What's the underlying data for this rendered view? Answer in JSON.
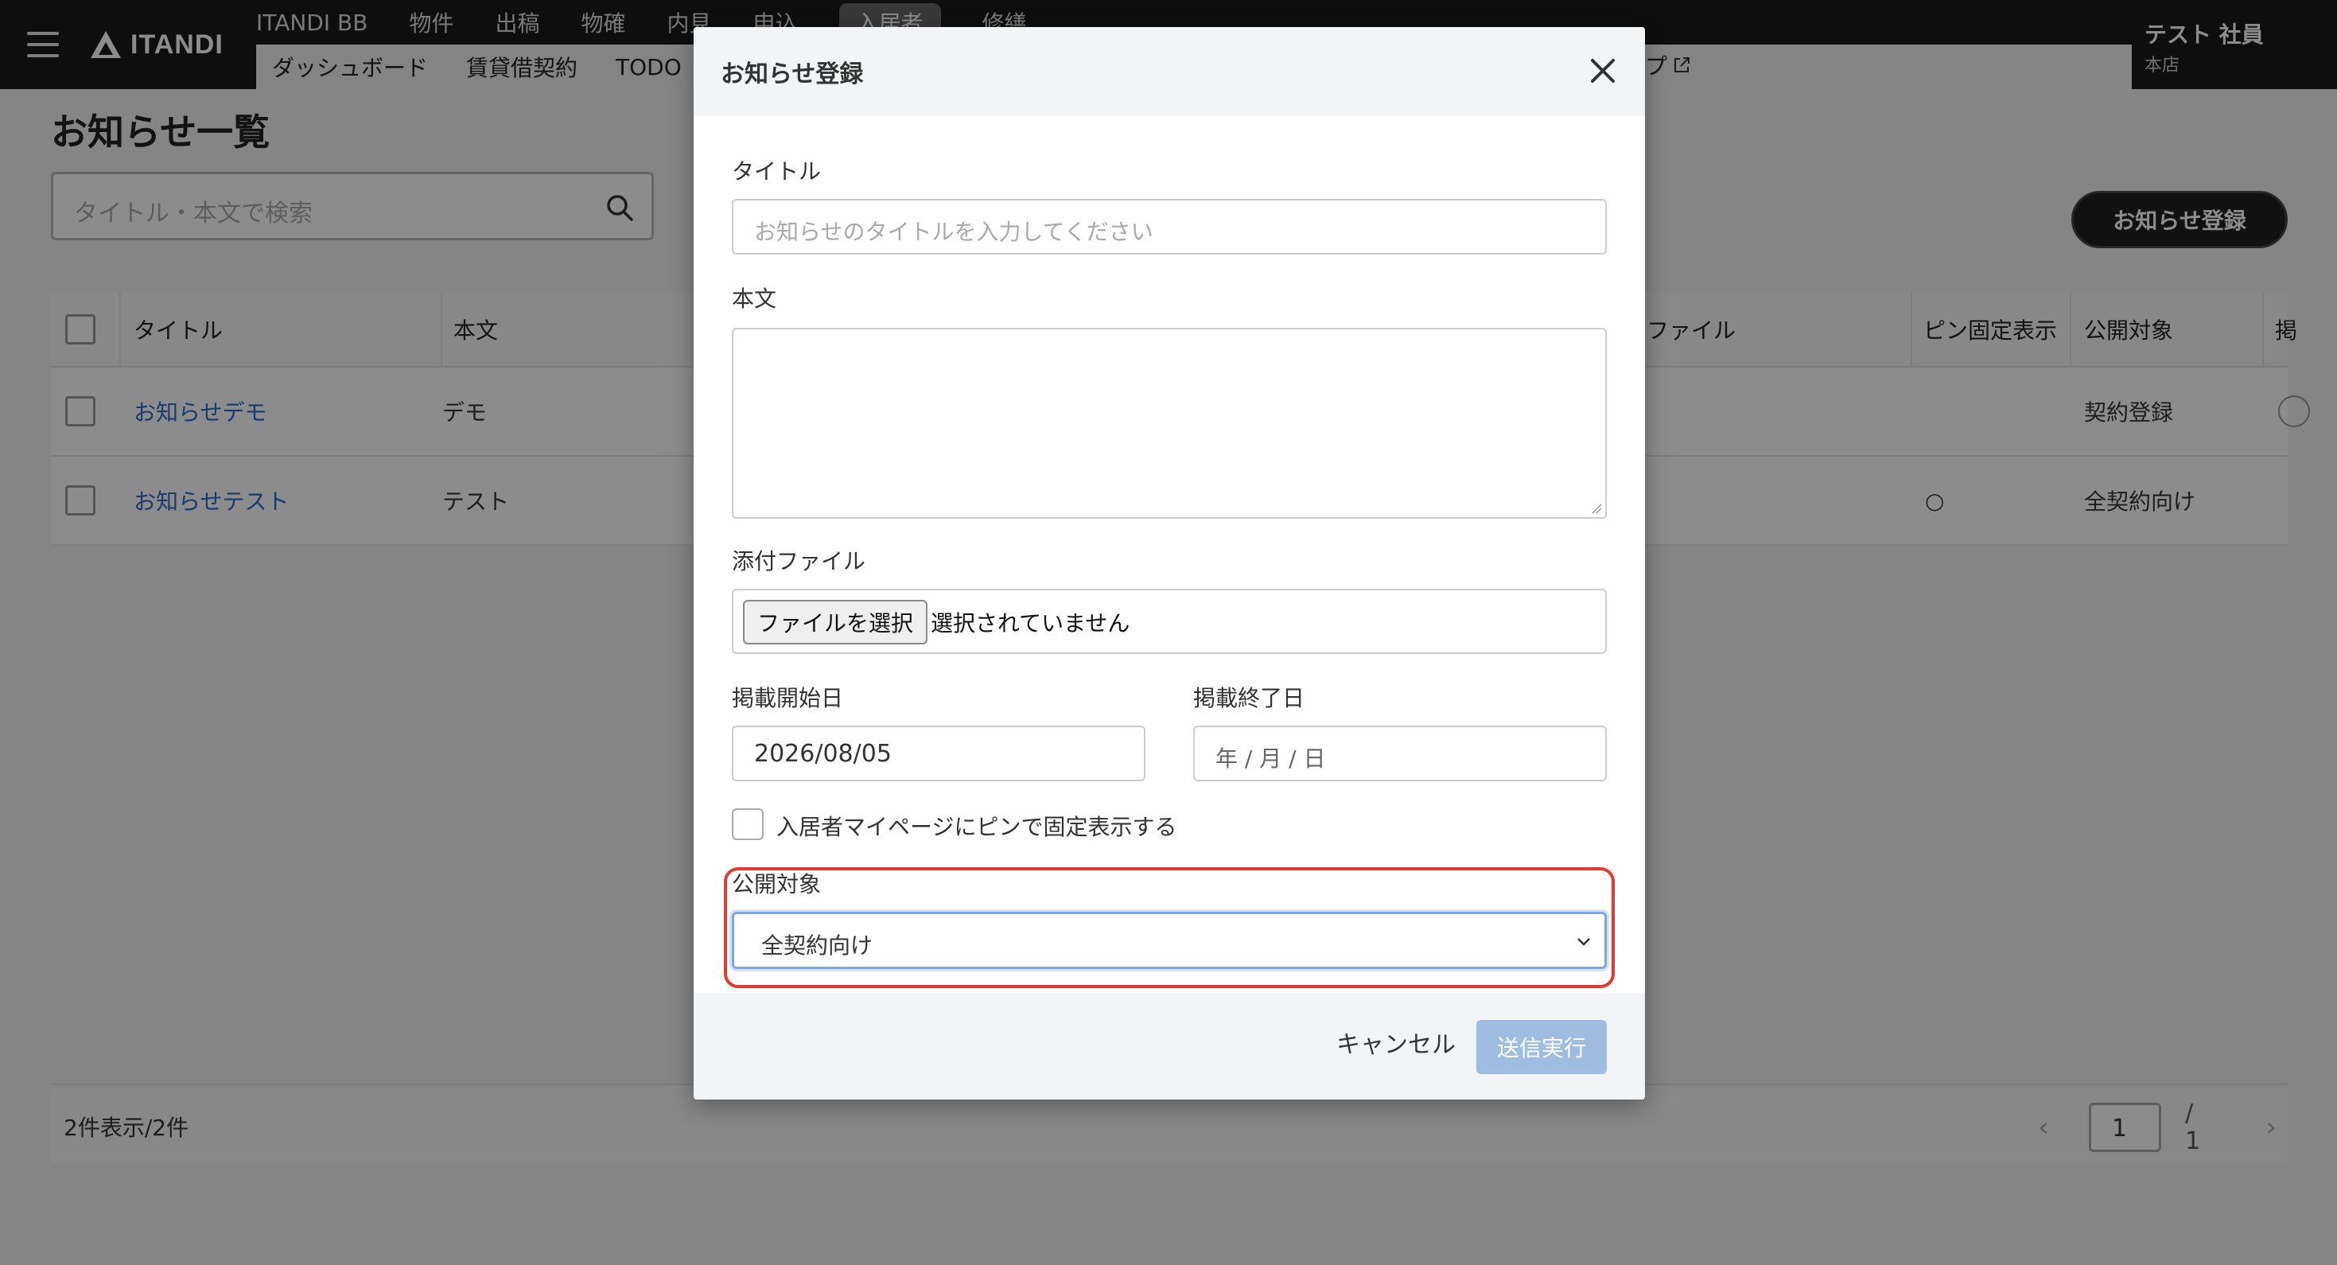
{
  "header": {
    "logo_text": "ITANDI",
    "nav_primary": [
      "ITANDI BB",
      "物件",
      "出稿",
      "物確",
      "内見",
      "申込",
      "入居者",
      "修繕"
    ],
    "nav_primary_active": "入居者",
    "nav_secondary": [
      "ダッシュボード",
      "賃貸借契約",
      "TODO"
    ],
    "nav_help": "ルプ",
    "user": {
      "name": "テスト 社員",
      "store": "本店"
    }
  },
  "page": {
    "title": "お知らせ一覧",
    "search_placeholder": "タイトル・本文で検索",
    "register_button": "お知らせ登録"
  },
  "table": {
    "headers": {
      "title": "タイトル",
      "body": "本文",
      "attachment": "ファイル",
      "pinned": "ピン固定表示",
      "target": "公開対象",
      "extra": "掲"
    },
    "rows": [
      {
        "title": "お知らせデモ",
        "body": "デモ",
        "pinned": "",
        "target": "契約登録"
      },
      {
        "title": "お知らせテスト",
        "body": "テスト",
        "pinned": "○",
        "target": "全契約向け"
      }
    ]
  },
  "footer": {
    "count": "2件表示/2件",
    "page": "1",
    "total": "/ 1"
  },
  "modal": {
    "title": "お知らせ登録",
    "title_label": "タイトル",
    "title_placeholder": "お知らせのタイトルを入力してください",
    "body_label": "本文",
    "attachment_label": "添付ファイル",
    "file_button": "ファイルを選択",
    "file_status": "選択されていません",
    "start_date_label": "掲載開始日",
    "start_date_value": "2026/08/05",
    "end_date_label": "掲載終了日",
    "end_date_placeholder": "年 / 月 / 日",
    "pin_label": "入居者マイページにピンで固定表示する",
    "target_label": "公開対象",
    "target_value": "全契約向け",
    "cancel_button": "キャンセル",
    "submit_button": "送信実行"
  },
  "colors": {
    "header_bg": "#1b1b1b",
    "link": "#2a6acb",
    "highlight": "#e43a2f",
    "submit_disabled": "#9ebde0"
  },
  "icons": [
    "hamburger-icon",
    "itandi-logo-icon",
    "search-icon",
    "close-icon",
    "chevron-down-icon",
    "external-link-icon",
    "chevron-left-icon",
    "chevron-right-icon"
  ]
}
